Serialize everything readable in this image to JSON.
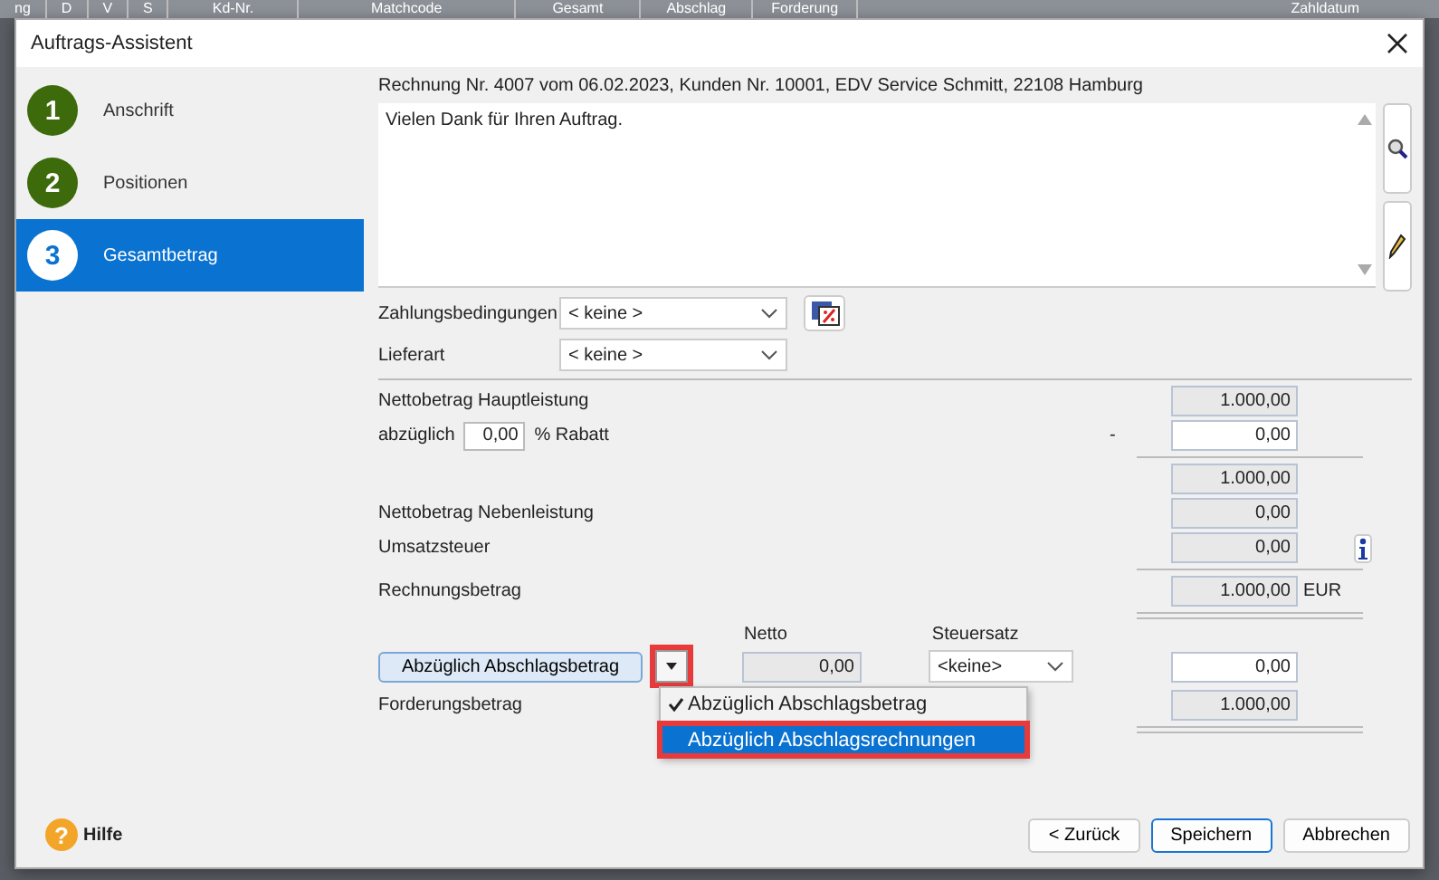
{
  "background_table": {
    "columns": [
      "ng",
      "D",
      "V",
      "S",
      "Kd-Nr.",
      "Matchcode",
      "Gesamt",
      "Abschlag",
      "Forderung",
      "Zahldatum"
    ]
  },
  "window": {
    "title": "Auftrags-Assistent"
  },
  "steps": [
    {
      "number": "1",
      "label": "Anschrift",
      "selected": false
    },
    {
      "number": "2",
      "label": "Positionen",
      "selected": false
    },
    {
      "number": "3",
      "label": "Gesamtbetrag",
      "selected": true
    }
  ],
  "header_text": "Rechnung Nr. 4007 vom 06.02.2023, Kunden Nr. 10001, EDV Service Schmitt, 22108 Hamburg",
  "note": {
    "value": "Vielen Dank für Ihren Auftrag."
  },
  "zahlungsbedingungen": {
    "label": "Zahlungsbedingungen",
    "value": "< keine >"
  },
  "lieferart": {
    "label": "Lieferart",
    "value": "< keine >"
  },
  "totals": {
    "hauptleistung": {
      "label": "Nettobetrag Hauptleistung",
      "value": "1.000,00"
    },
    "rabatt": {
      "label_before": "abzüglich",
      "percent": "0,00",
      "label_after": "% Rabatt",
      "sign": "-",
      "value": "0,00"
    },
    "zwischensumme": {
      "value": "1.000,00"
    },
    "nebenleistung": {
      "label": "Nettobetrag Nebenleistung",
      "value": "0,00"
    },
    "umsatzsteuer": {
      "label": "Umsatzsteuer",
      "value": "0,00"
    },
    "rechnungsbetrag": {
      "label": "Rechnungsbetrag",
      "value": "1.000,00",
      "currency": "EUR"
    },
    "abschlag": {
      "button": "Abzüglich Abschlagsbetrag",
      "toggle_highlighted": true,
      "netto_label": "Netto",
      "netto": "0,00",
      "steuersatz_label": "Steuersatz",
      "steuersatz": "<keine>",
      "value": "0,00",
      "menu": {
        "expanded": true,
        "selection_highlighted": true,
        "items": [
          {
            "label": "Abzüglich Abschlagsbetrag",
            "checked": true,
            "selected": false
          },
          {
            "label": "Abzüglich Abschlagsrechnungen",
            "checked": false,
            "selected": true
          }
        ]
      }
    },
    "forderungsbetrag": {
      "label": "Forderungsbetrag",
      "value": "1.000,00"
    }
  },
  "help": {
    "icon": "?",
    "label": "Hilfe"
  },
  "buttons": [
    {
      "label": "< Zurück",
      "default": false
    },
    {
      "label": "Speichern",
      "default": true
    },
    {
      "label": "Abbrechen",
      "default": false
    }
  ]
}
